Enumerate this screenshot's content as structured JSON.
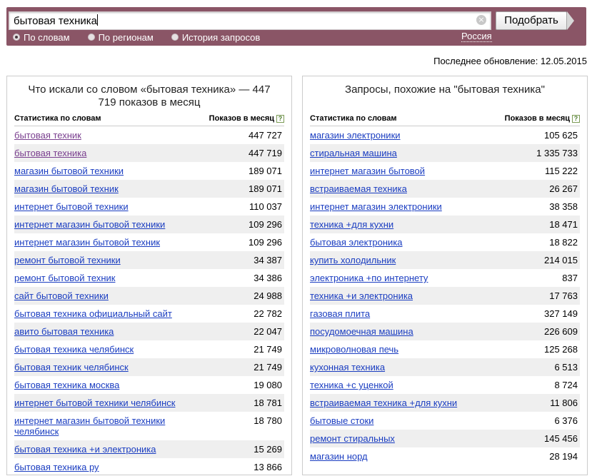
{
  "search": {
    "query": "бытовая техника",
    "button_label": "Подобрать",
    "clear_glyph": "×",
    "modes": [
      {
        "label": "По словам",
        "active": true
      },
      {
        "label": "По регионам",
        "active": false
      },
      {
        "label": "История запросов",
        "active": false
      }
    ],
    "region": "Россия"
  },
  "last_update": "Последнее обновление: 12.05.2015",
  "left_panel": {
    "title": "Что искали со словом «бытовая техника» — 447 719 показов в месяц",
    "col_phrase": "Статистика по словам",
    "col_count": "Показов в месяц",
    "help_glyph": "?",
    "rows": [
      {
        "phrase": "бытовая техник",
        "count": "447 727",
        "visited": true
      },
      {
        "phrase": "бытовая техника",
        "count": "447 719",
        "visited": true
      },
      {
        "phrase": "магазин бытовой техники",
        "count": "189 071",
        "visited": false
      },
      {
        "phrase": "магазин бытовой техник",
        "count": "189 071",
        "visited": false
      },
      {
        "phrase": "интернет бытовой техники",
        "count": "110 037",
        "visited": false
      },
      {
        "phrase": "интернет магазин бытовой техники",
        "count": "109 296",
        "visited": false
      },
      {
        "phrase": "интернет магазин бытовой техник",
        "count": "109 296",
        "visited": false
      },
      {
        "phrase": "ремонт бытовой техники",
        "count": "34 387",
        "visited": false
      },
      {
        "phrase": "ремонт бытовой техник",
        "count": "34 386",
        "visited": false
      },
      {
        "phrase": "сайт бытовой техники",
        "count": "24 988",
        "visited": false
      },
      {
        "phrase": "бытовая техника официальный сайт",
        "count": "22 782",
        "visited": false
      },
      {
        "phrase": "авито бытовая техника",
        "count": "22 047",
        "visited": false
      },
      {
        "phrase": "бытовая техника челябинск",
        "count": "21 749",
        "visited": false
      },
      {
        "phrase": "бытовая техник челябинск",
        "count": "21 749",
        "visited": false
      },
      {
        "phrase": "бытовая техника москва",
        "count": "19 080",
        "visited": false
      },
      {
        "phrase": "интернет бытовой техники челябинск",
        "count": "18 781",
        "visited": false
      },
      {
        "phrase": "интернет магазин бытовой техники челябинск",
        "count": "18 780",
        "visited": false,
        "tall": true
      },
      {
        "phrase": "бытовая техника +и электроника",
        "count": "15 269",
        "visited": false
      },
      {
        "phrase": "бытовая техника ру",
        "count": "13 866",
        "visited": false
      }
    ]
  },
  "right_panel": {
    "title": "Запросы, похожие на \"бытовая техника\"",
    "col_phrase": "Статистика по словам",
    "col_count": "Показов в месяц",
    "help_glyph": "?",
    "rows": [
      {
        "phrase": "магазин электроники",
        "count": "105 625"
      },
      {
        "phrase": "стиральная машина",
        "count": "1 335 733"
      },
      {
        "phrase": "интернет магазин бытовой",
        "count": "115 222"
      },
      {
        "phrase": "встраиваемая техника",
        "count": "26 267"
      },
      {
        "phrase": "интернет магазин электроники",
        "count": "38 358"
      },
      {
        "phrase": "техника +для кухни",
        "count": "18 471"
      },
      {
        "phrase": "бытовая электроника",
        "count": "18 822"
      },
      {
        "phrase": "купить холодильник",
        "count": "214 015"
      },
      {
        "phrase": "электроника +по интернету",
        "count": "837"
      },
      {
        "phrase": "техника +и электроника",
        "count": "17 763"
      },
      {
        "phrase": "газовая плита",
        "count": "327 149"
      },
      {
        "phrase": "посудомоечная машина",
        "count": "226 609"
      },
      {
        "phrase": "микроволновая печь",
        "count": "125 268"
      },
      {
        "phrase": "кухонная техника",
        "count": "6 513"
      },
      {
        "phrase": "техника +с уценкой",
        "count": "8 724"
      },
      {
        "phrase": "встраиваемая техника +для кухни",
        "count": "11 806"
      },
      {
        "phrase": "бытовые стоки",
        "count": "6 376"
      },
      {
        "phrase": "ремонт стиральных",
        "count": "145 456"
      },
      {
        "phrase": "магазин норд",
        "count": "28 194"
      }
    ]
  }
}
